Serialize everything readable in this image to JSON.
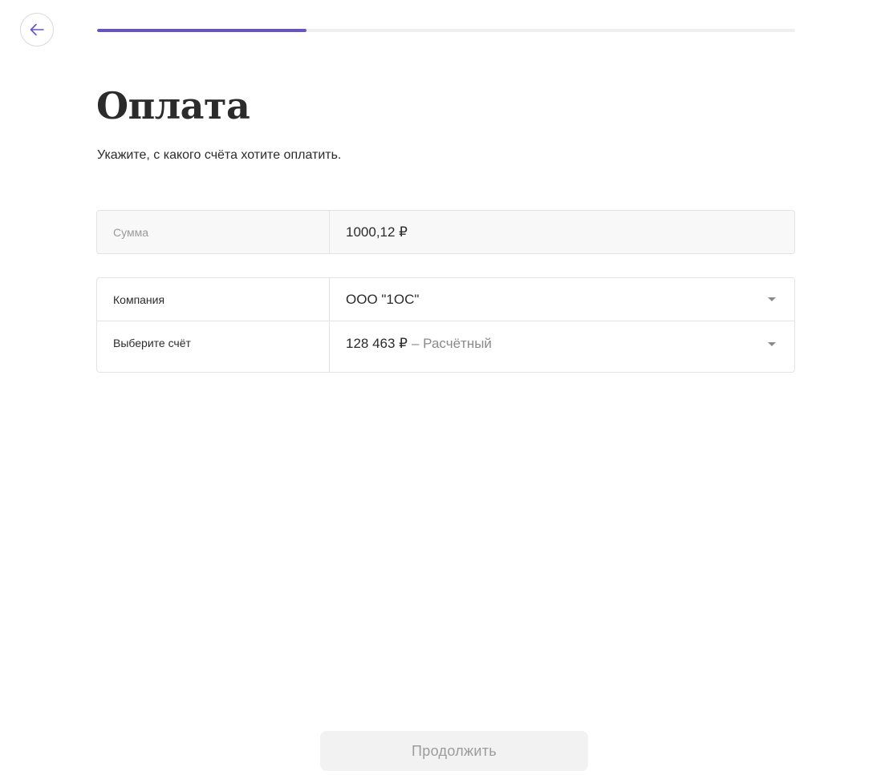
{
  "header": {
    "back_icon": "arrow-left-icon",
    "progress_fraction": 0.3,
    "colors": {
      "accent": "#6952c8",
      "track": "#efefef"
    }
  },
  "main": {
    "title": "Оплата",
    "subtitle": "Укажите, с какого счёта хотите оплатить."
  },
  "amount": {
    "label": "Сумма",
    "value": "1000,12 ₽"
  },
  "form": {
    "company": {
      "label": "Компания",
      "value": "ООО \"1ОС\"",
      "icon": "caret-down-icon"
    },
    "account": {
      "label": "Выберите счёт",
      "balance": "128 463 ₽",
      "type": "– Расчётный",
      "icon": "caret-down-icon"
    }
  },
  "footer": {
    "continue_label": "Продолжить"
  }
}
